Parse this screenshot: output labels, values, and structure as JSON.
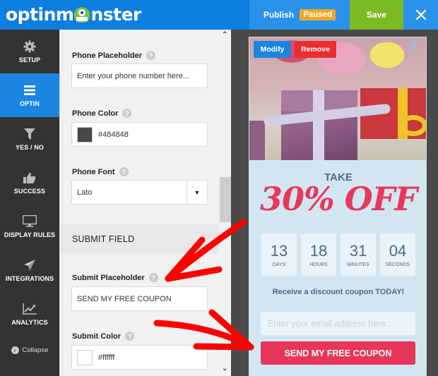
{
  "app": {
    "logo_text_left": "optinm",
    "logo_text_right": "nster"
  },
  "topbar": {
    "publish_label": "Publish",
    "status_badge": "Paused",
    "save_label": "Save",
    "close_icon": "×"
  },
  "sidebar": {
    "items": [
      {
        "label": "SETUP",
        "icon": "gear-icon",
        "active": false
      },
      {
        "label": "OPTIN",
        "icon": "menu-icon",
        "active": true
      },
      {
        "label": "YES / NO",
        "icon": "filter-icon",
        "active": false
      },
      {
        "label": "SUCCESS",
        "icon": "thumbs-up-icon",
        "active": false
      },
      {
        "label": "DISPLAY RULES",
        "icon": "monitor-icon",
        "active": false
      },
      {
        "label": "INTEGRATIONS",
        "icon": "paper-plane-icon",
        "active": false
      },
      {
        "label": "ANALYTICS",
        "icon": "chart-icon",
        "active": false
      }
    ],
    "collapse_label": "Collapse"
  },
  "panel": {
    "phone_placeholder_label": "Phone Placeholder",
    "phone_placeholder_value": "Enter your phone number here...",
    "phone_color_label": "Phone Color",
    "phone_color_value": "#484848",
    "phone_font_label": "Phone Font",
    "phone_font_value": "Lato",
    "section_title": "SUBMIT FIELD",
    "submit_placeholder_label": "Submit Placeholder",
    "submit_placeholder_value": "SEND MY FREE COUPON",
    "submit_color_label": "Submit Color",
    "submit_color_value": "#ffffff",
    "help_glyph": "?"
  },
  "preview": {
    "modify_label": "Modify",
    "remove_label": "Remove",
    "close_glyph": "✖",
    "take_label": "TAKE",
    "headline": "30% OFF",
    "countdown": [
      {
        "value": "13",
        "unit": "DAYS"
      },
      {
        "value": "18",
        "unit": "HOURS"
      },
      {
        "value": "31",
        "unit": "MINUTES"
      },
      {
        "value": "04",
        "unit": "SECONDS"
      }
    ],
    "subtext": "Receive a discount coupon TODAY!",
    "email_placeholder": "Enter your email address here...",
    "submit_label": "SEND MY FREE COUPON"
  },
  "colors": {
    "brand_blue": "#0d7fe0",
    "save_green": "#7cba24",
    "paused_orange": "#f4a623",
    "accent_red": "#e8365a",
    "annotation_red": "#ff0000"
  }
}
